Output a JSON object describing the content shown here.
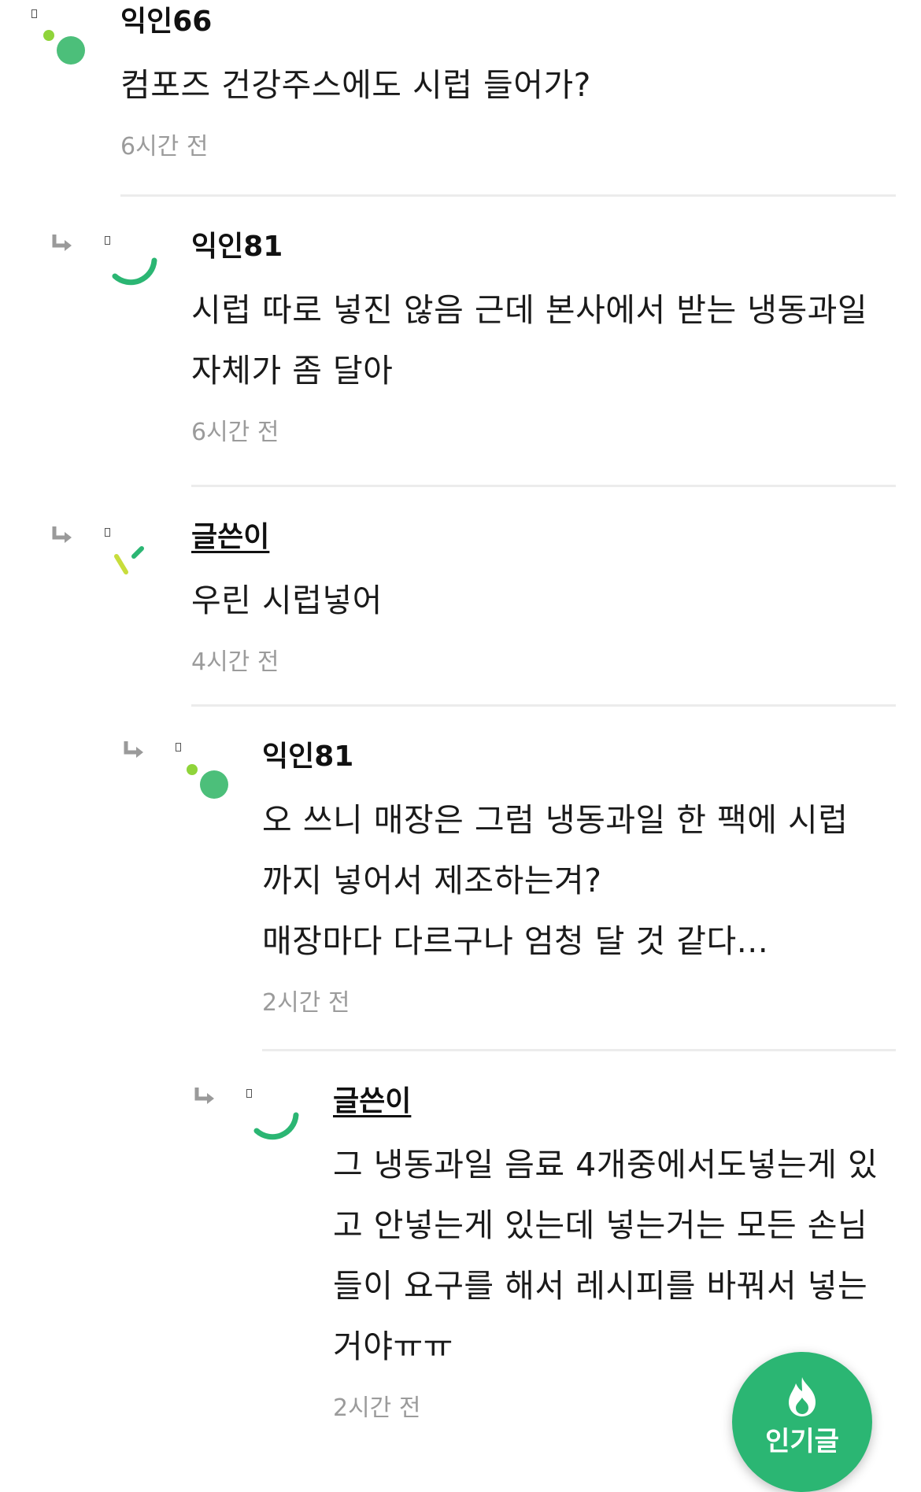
{
  "comments": [
    {
      "author": "익인66",
      "is_op": false,
      "body": "컴포즈 건강주스에도 시럽 들어가?",
      "time": "6시간 전",
      "depth": 0,
      "avatar": "dots-icon"
    },
    {
      "author": "익인81",
      "is_op": false,
      "body": "시럽 따로 넣진 않음 근데 본사에서 받는 냉동과일\n자체가 좀 달아",
      "time": "6시간 전",
      "depth": 1,
      "avatar": "arc-icon"
    },
    {
      "author": "글쓴이",
      "is_op": true,
      "body": "우린 시럽넣어",
      "time": "4시간 전",
      "depth": 1,
      "avatar": "sticks-icon"
    },
    {
      "author": "익인81",
      "is_op": false,
      "body": "오 쓰니 매장은 그럼 냉동과일 한 팩에 시럽\n까지 넣어서 제조하는겨?\n매장마다 다르구나 엄청 달 것 같다...",
      "time": "2시간 전",
      "depth": 2,
      "avatar": "dots-icon"
    },
    {
      "author": "글쓴이",
      "is_op": true,
      "body": "그 냉동과일 음료 4개중에서도넣는게 있\n고 안넣는게 있는데 넣는거는 모든 손님\n들이 요구를 해서 레시피를 바꿔서 넣는\n거야ㅠㅠ",
      "time": "2시간 전",
      "depth": 3,
      "avatar": "arc-icon"
    }
  ],
  "fab": {
    "label": "인기글",
    "icon": "fire-icon"
  },
  "colors": {
    "accent": "#2bb673",
    "avatar_green": "#4cbf7a",
    "avatar_lime": "#8fd43a",
    "text": "#1a1a1a",
    "muted": "#9b9b9b",
    "divider": "#ececec"
  }
}
